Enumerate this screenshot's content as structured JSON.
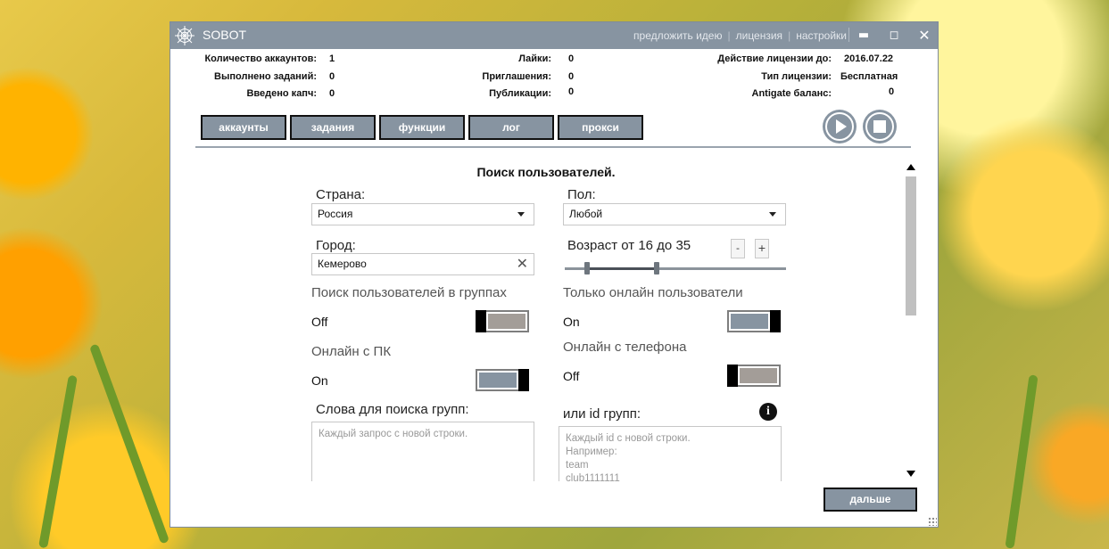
{
  "app": {
    "title": "SOBOT",
    "links": [
      "предложить идею",
      "лицензия",
      "настройки"
    ]
  },
  "stats": {
    "accounts_label": "Количество аккаунтов:",
    "accounts_value": "1",
    "tasks_done_label": "Выполнено заданий:",
    "tasks_done_value": "0",
    "captcha_label": "Введено капч:",
    "captcha_value": "0",
    "likes_label": "Лайки:",
    "likes_value": "0",
    "invites_label": "Приглашения:",
    "invites_value": "0",
    "posts_label": "Публикации:",
    "posts_value": "0",
    "license_until_label": "Действие лицензии до:",
    "license_until_value": "2016.07.22",
    "license_type_label": "Тип лицензии:",
    "license_type_value": "Бесплатная",
    "antigate_label": "Antigate баланс:",
    "antigate_value": "0"
  },
  "tabs": [
    "аккаунты",
    "задания",
    "функции",
    "лог",
    "прокси"
  ],
  "form": {
    "title": "Поиск пользователей.",
    "country_label": "Страна:",
    "country_value": "Россия",
    "gender_label": "Пол:",
    "gender_value": "Любой",
    "city_label": "Город:",
    "city_value": "Кемерово",
    "age_label": "Возраст от 16 до 35",
    "age_from": 16,
    "age_to": 35,
    "age_min": 10,
    "age_max": 70,
    "age_minus": "-",
    "age_plus": "+",
    "group_search_label": "Поиск пользователей в группах",
    "group_search_state": "Off",
    "online_only_label": "Только онлайн пользователи",
    "online_only_state": "On",
    "online_pc_label": "Онлайн с ПК",
    "online_pc_state": "On",
    "online_phone_label": "Онлайн с телефона",
    "online_phone_state": "Off",
    "group_words_label": "Слова для поиска групп:",
    "group_words_placeholder": "Каждый запрос с новой строки.",
    "group_ids_label": "или id групп:",
    "group_ids_placeholder": "Каждый id с новой строки.\nНапример:\nteam\nclub1111111"
  },
  "next_button": "дальше",
  "colors": {
    "accent": "#8794a1",
    "toggle_off": "#a39d98"
  }
}
